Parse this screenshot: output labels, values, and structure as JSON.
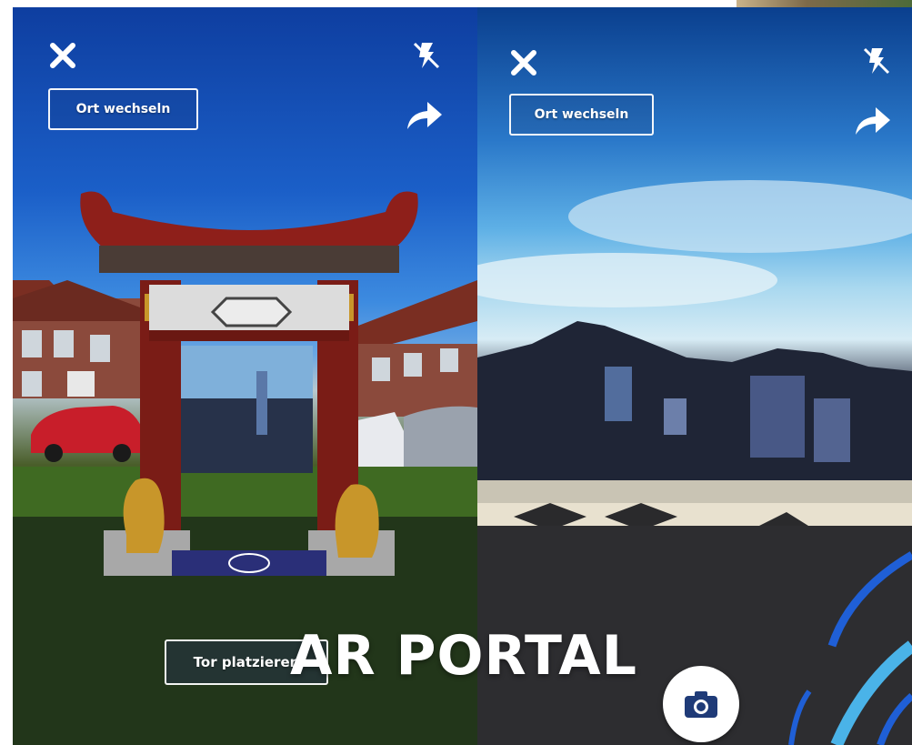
{
  "overlay": {
    "title": "AR PORTAL"
  },
  "left_screen": {
    "change_location_label": "Ort wechseln",
    "place_gate_label": "Tor platzieren",
    "icons": {
      "close": "close-icon",
      "flash": "flash-off-icon",
      "share": "share-icon"
    }
  },
  "right_screen": {
    "change_location_label": "Ort wechseln",
    "icons": {
      "close": "close-icon",
      "flash": "flash-off-icon",
      "share": "share-icon",
      "camera": "camera-icon"
    }
  },
  "colors": {
    "accent_blue": "#1f5fd6",
    "light_blue": "#4ab3e8",
    "gate_red": "#8e1f1a",
    "gold": "#c8962a"
  }
}
